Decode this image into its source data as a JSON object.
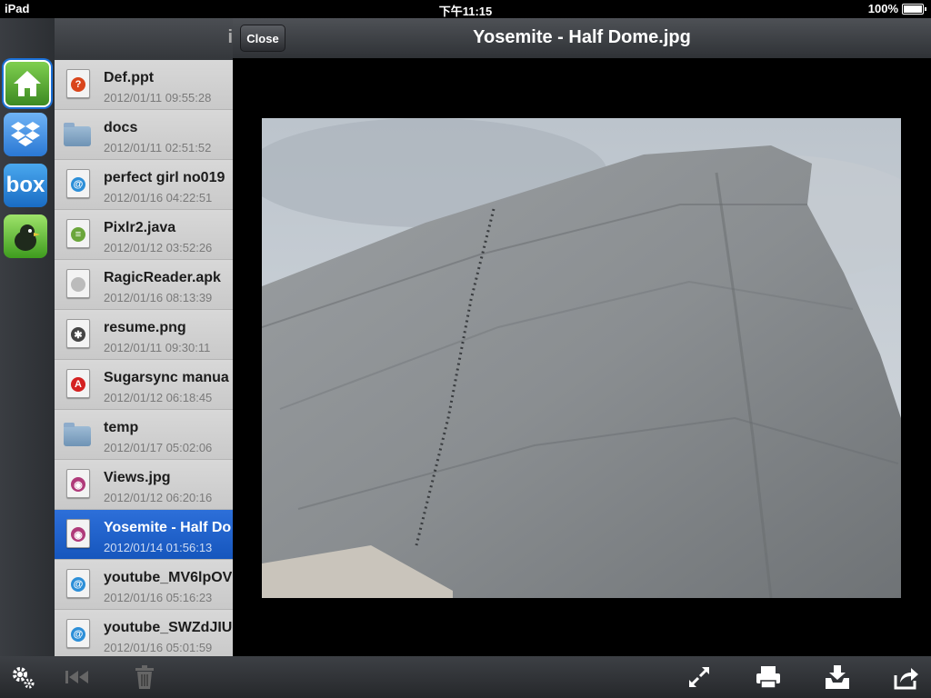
{
  "statusbar": {
    "device": "iPad",
    "time": "下午11:15",
    "battery": "100%"
  },
  "rail": {
    "icons": [
      "home-icon",
      "dropbox-icon",
      "box-icon",
      "bird-icon"
    ],
    "box_label": "box"
  },
  "listheader": {
    "hint": "i"
  },
  "files": [
    {
      "name": "Def.ppt",
      "date": "2012/01/11 09:55:28",
      "icon": "ppt-file-icon",
      "badge": "?",
      "color": "#d9451b"
    },
    {
      "name": "docs",
      "date": "2012/01/11 02:51:52",
      "icon": "folder-icon"
    },
    {
      "name": "perfect girl no019",
      "date": "2012/01/16 04:22:51",
      "icon": "video-file-icon",
      "badge": "@",
      "color": "#2d8fd8"
    },
    {
      "name": "Pixlr2.java",
      "date": "2012/01/12 03:52:26",
      "icon": "text-file-icon",
      "badge": "≡",
      "color": "#6ba63b"
    },
    {
      "name": "RagicReader.apk",
      "date": "2012/01/16 08:13:39",
      "icon": "generic-file-icon",
      "badge": "",
      "color": "#bbbbbb"
    },
    {
      "name": "resume.png",
      "date": "2012/01/11 09:30:11",
      "icon": "image-file-icon",
      "badge": "✱",
      "color": "#444444"
    },
    {
      "name": "Sugarsync manua",
      "date": "2012/01/12 06:18:45",
      "icon": "pdf-file-icon",
      "badge": "A",
      "color": "#d42121"
    },
    {
      "name": "temp",
      "date": "2012/01/17 05:02:06",
      "icon": "folder-icon"
    },
    {
      "name": "Views.jpg",
      "date": "2012/01/12 06:20:16",
      "icon": "photo-file-icon",
      "badge": "◉",
      "color": "#b03a7a"
    },
    {
      "name": "Yosemite - Half Do",
      "date": "2012/01/14 01:56:13",
      "icon": "photo-file-icon",
      "badge": "◉",
      "color": "#b03a7a",
      "selected": true
    },
    {
      "name": "youtube_MV6lpOV",
      "date": "2012/01/16 05:16:23",
      "icon": "video-file-icon",
      "badge": "@",
      "color": "#2d8fd8"
    },
    {
      "name": "youtube_SWZdJIU",
      "date": "2012/01/16 05:01:59",
      "icon": "video-file-icon",
      "badge": "@",
      "color": "#2d8fd8"
    }
  ],
  "viewer": {
    "close_label": "Close",
    "title": "Yosemite - Half Dome.jpg"
  },
  "toolbar": {
    "left": [
      "gear-icon",
      "skip-back-icon",
      "trash-icon"
    ],
    "right": [
      "fullscreen-icon",
      "print-icon",
      "download-icon",
      "share-icon"
    ]
  },
  "colors": {
    "selection": "#1a5fcc",
    "toolbar": "#2f3236"
  }
}
